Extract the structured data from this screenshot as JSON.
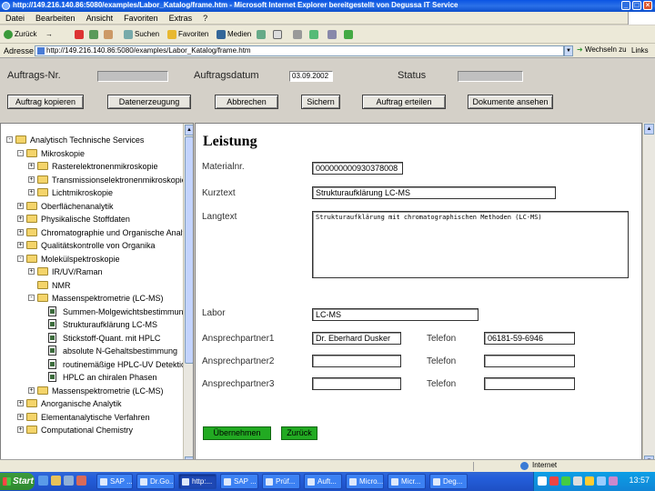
{
  "window": {
    "title": "http://149.216.140.86:5080/examples/Labor_Katalog/frame.htm - Microsoft Internet Explorer bereitgestellt von Degussa IT Service",
    "minimize_symbol": "_",
    "maximize_symbol": "□",
    "close_symbol": "×"
  },
  "menu": [
    "Datei",
    "Bearbeiten",
    "Ansicht",
    "Favoriten",
    "Extras",
    "?"
  ],
  "toolbar": {
    "back_label": "Zurück",
    "forward_symbol": "→",
    "search_label": "Suchen",
    "favorites_label": "Favoriten",
    "media_label": "Medien"
  },
  "address_bar": {
    "label": "Adresse",
    "url": "http://149.216.140.86:5080/examples/Labor_Katalog/frame.htm",
    "go_label": "Wechseln zu",
    "links_label": "Links"
  },
  "header": {
    "auftrags_nr_label": "Auftrags-Nr.",
    "auftrags_nr_value": "",
    "auftragsdatum_label": "Auftragsdatum",
    "auftragsdatum_value": "03.09.2002",
    "status_label": "Status",
    "status_value": "",
    "buttons": [
      "Auftrag kopieren",
      "Datenerzeugung",
      "Abbrechen",
      "Sichern",
      "Auftrag erteilen",
      "Dokumente ansehen"
    ]
  },
  "tree": {
    "items": [
      {
        "label": "Analytisch Technische Services",
        "indent": 0,
        "type": "folder",
        "expander": "-"
      },
      {
        "label": "Mikroskopie",
        "indent": 1,
        "type": "folder",
        "expander": "-"
      },
      {
        "label": "Rasterelektronenmikroskopie",
        "indent": 2,
        "type": "folder",
        "expander": "+"
      },
      {
        "label": "Transmissionselektronenmikroskopie",
        "indent": 2,
        "type": "folder",
        "expander": "+"
      },
      {
        "label": "Lichtmikroskopie",
        "indent": 2,
        "type": "folder",
        "expander": "+"
      },
      {
        "label": "Oberflächenanalytik",
        "indent": 1,
        "type": "folder",
        "expander": "+"
      },
      {
        "label": "Physikalische Stoffdaten",
        "indent": 1,
        "type": "folder",
        "expander": "+"
      },
      {
        "label": "Chromatographie und Organische Analytik",
        "indent": 1,
        "type": "folder",
        "expander": "+"
      },
      {
        "label": "Qualitätskontrolle von Organika",
        "indent": 1,
        "type": "folder",
        "expander": "+"
      },
      {
        "label": "Molekülspektroskopie",
        "indent": 1,
        "type": "folder",
        "expander": "-"
      },
      {
        "label": "IR/UV/Raman",
        "indent": 2,
        "type": "folder",
        "expander": "+"
      },
      {
        "label": "NMR",
        "indent": 2,
        "type": "folder",
        "expander": ""
      },
      {
        "label": "Massenspektrometrie (LC-MS)",
        "indent": 2,
        "type": "folder",
        "expander": "-"
      },
      {
        "label": "Summen-Molgewichtsbestimmung",
        "indent": 3,
        "type": "doc",
        "expander": ""
      },
      {
        "label": "Strukturaufklärung LC-MS",
        "indent": 3,
        "type": "doc",
        "expander": ""
      },
      {
        "label": "Stickstoff-Quant. mit HPLC",
        "indent": 3,
        "type": "doc",
        "expander": ""
      },
      {
        "label": "absolute N-Gehaltsbestimmung",
        "indent": 3,
        "type": "doc",
        "expander": ""
      },
      {
        "label": "routinemäßige HPLC-UV Detektion",
        "indent": 3,
        "type": "doc",
        "expander": ""
      },
      {
        "label": "HPLC an chiralen Phasen",
        "indent": 3,
        "type": "doc",
        "expander": ""
      },
      {
        "label": "Massenspektrometrie (LC-MS)",
        "indent": 2,
        "type": "folder",
        "expander": "+"
      },
      {
        "label": "Anorganische Analytik",
        "indent": 1,
        "type": "folder",
        "expander": "+"
      },
      {
        "label": "Elementanalytische Verfahren",
        "indent": 1,
        "type": "folder",
        "expander": "+"
      },
      {
        "label": "Computational Chemistry",
        "indent": 1,
        "type": "folder",
        "expander": "+"
      }
    ]
  },
  "detail": {
    "title": "Leistung",
    "materialnr_label": "Materialnr.",
    "materialnr_value": "000000000930378008",
    "kurztext_label": "Kurztext",
    "kurztext_value": "Strukturaufklärung LC-MS",
    "langtext_label": "Langtext",
    "langtext_value": "Strukturaufklärung mit chromatographischen Methoden (LC-MS)",
    "labor_label": "Labor",
    "labor_value": "LC-MS",
    "ansprechpartner1_label": "Ansprechpartner1",
    "ansprechpartner1_value": "Dr. Eberhard Dusker",
    "telefon1_label": "Telefon",
    "telefon1_value": "06181-59-6946",
    "ansprechpartner2_label": "Ansprechpartner2",
    "ansprechpartner2_value": "",
    "telefon2_label": "Telefon",
    "telefon2_value": "",
    "ansprechpartner3_label": "Ansprechpartner3",
    "ansprechpartner3_value": "",
    "telefon3_label": "Telefon",
    "telefon3_value": "",
    "accept_label": "Übernehmen",
    "back_label": "Zurück"
  },
  "statusbar": {
    "zone_label": "Internet"
  },
  "taskbar": {
    "start_label": "Start",
    "items": [
      "SAP ...",
      "Dr.Go...",
      "http:...",
      "SAP ...",
      "Prüf...",
      "Auft...",
      "Micro...",
      "Micr...",
      "Deg..."
    ],
    "clock": "13:57"
  },
  "colors": {
    "title_bar": "#0a54e3",
    "green_button": "#22aa22",
    "taskbar": "#245edb"
  }
}
